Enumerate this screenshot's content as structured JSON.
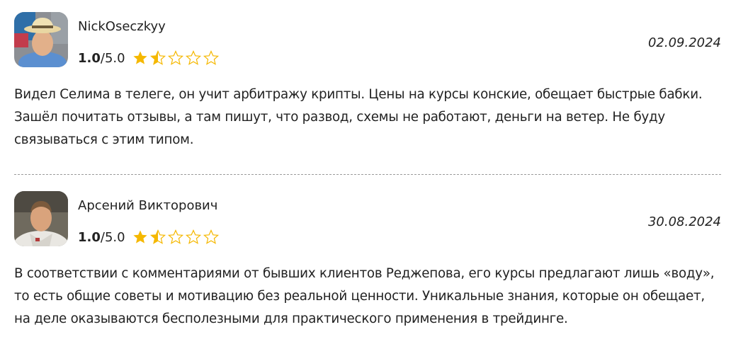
{
  "reviews": [
    {
      "author": "NickOseczkyy",
      "score": "1.0",
      "max": "/5.0",
      "date": "02.09.2024",
      "stars_filled": 1.5,
      "text": "Видел Селима в телеге, он учит арбитражу крипты. Цены на курсы конские, обещает быстрые бабки. Зашёл почитать отзывы, а там пишут, что развод, схемы не работают, деньги на ветер. Не буду связываться с этим типом."
    },
    {
      "author": "Арсений Викторович",
      "score": "1.0",
      "max": "/5.0",
      "date": "30.08.2024",
      "stars_filled": 1.5,
      "text": "В соответствии с комментариями от бывших клиентов Реджепова, его курсы предлагают лишь «воду», то есть общие советы и мотивацию без реальной ценности. Уникальные знания, которые он обещает, на деле оказываются бесполезными для практического применения в трейдинге."
    }
  ],
  "colors": {
    "star": "#f5b800",
    "star_empty_stroke": "#f5b800",
    "text": "#222222",
    "divider": "#9a9a9a"
  }
}
